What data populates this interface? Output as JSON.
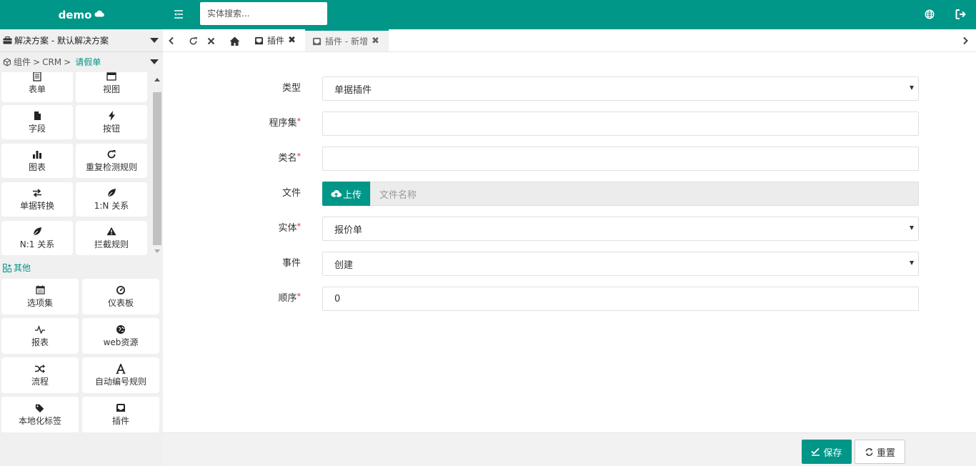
{
  "brand": {
    "name": "demo"
  },
  "search": {
    "placeholder": "实体搜索..."
  },
  "sidebar": {
    "solution": "解决方案 - 默认解决方案",
    "breadcrumb": {
      "part1": "组件",
      "sep": ">",
      "part2": "CRM",
      "part3": "请假单"
    },
    "components": [
      {
        "label": "表单",
        "icon": "form-icon"
      },
      {
        "label": "视图",
        "icon": "view-icon"
      },
      {
        "label": "字段",
        "icon": "file-icon"
      },
      {
        "label": "按钮",
        "icon": "bolt-icon"
      },
      {
        "label": "图表",
        "icon": "bar-chart-icon"
      },
      {
        "label": "重复检测规则",
        "icon": "refresh-icon"
      },
      {
        "label": "单据转换",
        "icon": "exchange-icon"
      },
      {
        "label": "1:N 关系",
        "icon": "leaf-icon"
      },
      {
        "label": "N:1 关系",
        "icon": "leaf-icon"
      },
      {
        "label": "拦截规则",
        "icon": "warning-icon"
      }
    ],
    "others_title": "其他",
    "others": [
      {
        "label": "选项集",
        "icon": "calendar-icon"
      },
      {
        "label": "仪表板",
        "icon": "dashboard-icon"
      },
      {
        "label": "报表",
        "icon": "pulse-icon"
      },
      {
        "label": "web资源",
        "icon": "globe-icon"
      },
      {
        "label": "流程",
        "icon": "shuffle-icon"
      },
      {
        "label": "自动编号规则",
        "icon": "font-icon"
      },
      {
        "label": "本地化标签",
        "icon": "tags-icon"
      },
      {
        "label": "插件",
        "icon": "inbox-icon"
      }
    ]
  },
  "tabs": [
    {
      "label": "插件",
      "close": "✖"
    },
    {
      "label": "插件 - 新增",
      "close": "✖"
    }
  ],
  "form": {
    "type": {
      "label": "类型",
      "value": "单据插件"
    },
    "assembly": {
      "label": "程序集",
      "required": "*",
      "value": ""
    },
    "classname": {
      "label": "类名",
      "required": "*",
      "value": ""
    },
    "file": {
      "label": "文件",
      "upload_label": "上传",
      "placeholder": "文件名称"
    },
    "entity": {
      "label": "实体",
      "required": "*",
      "value": "报价单"
    },
    "event": {
      "label": "事件",
      "value": "创建"
    },
    "order": {
      "label": "顺序",
      "required": "*",
      "value": "0"
    }
  },
  "footer": {
    "save_label": "保存",
    "reset_label": "重置"
  },
  "colors": {
    "primary": "#009688",
    "required": "#e02020"
  }
}
